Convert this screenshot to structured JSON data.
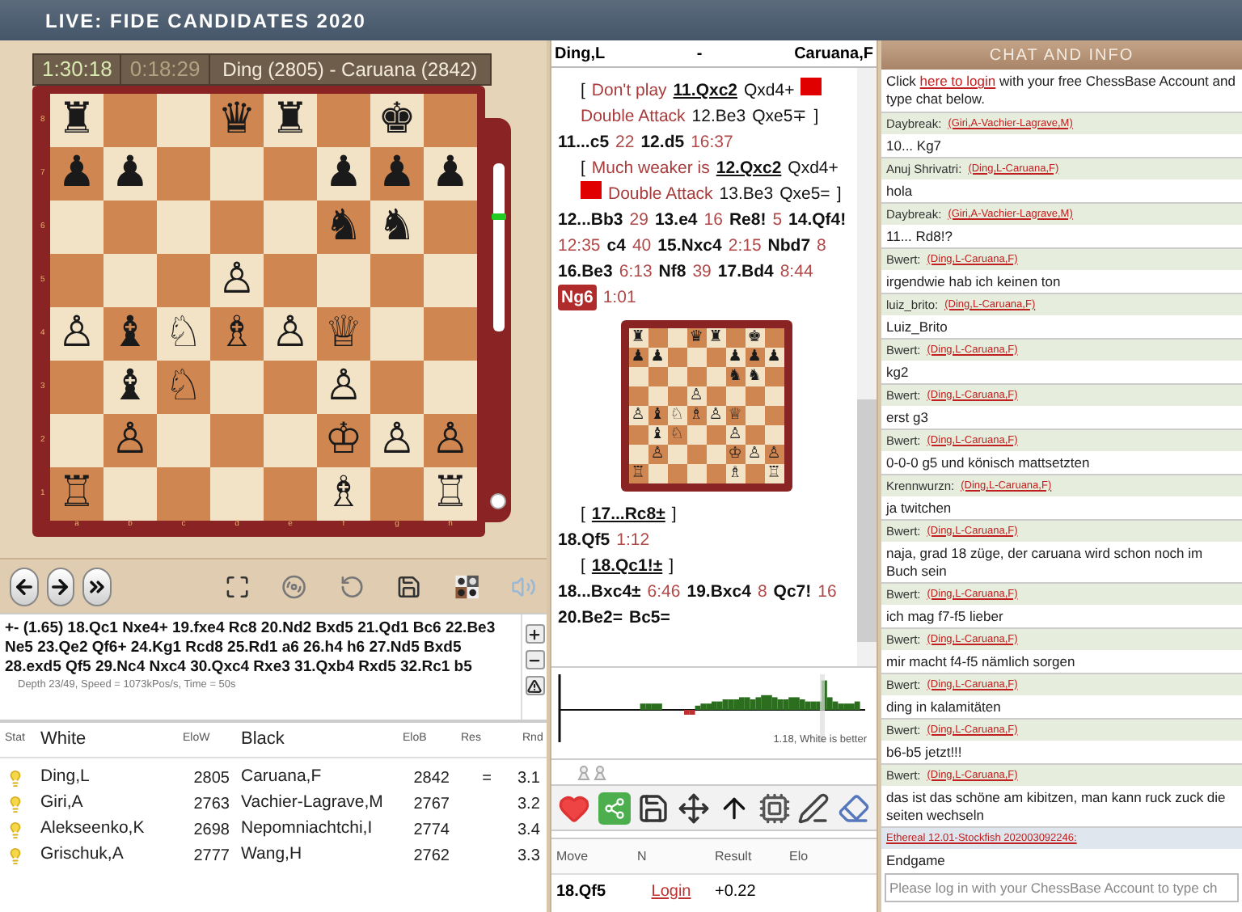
{
  "header": {
    "title": "LIVE: FIDE CANDIDATES 2020"
  },
  "board_panel": {
    "clocks": [
      {
        "time": "1:30:18",
        "active": true
      },
      {
        "time": "0:18:29",
        "active": false
      }
    ],
    "game_title": "Ding (2805) - Caruana (2842)",
    "ranks": [
      [
        {
          "kind": "piece",
          "glyph": "♜"
        },
        {
          "kind": "empty"
        },
        {
          "kind": "empty"
        },
        {
          "kind": "piece",
          "glyph": "♛"
        },
        {
          "kind": "piece",
          "glyph": "♜"
        },
        {
          "kind": "empty"
        },
        {
          "kind": "piece",
          "glyph": "♚"
        },
        {
          "kind": "empty"
        }
      ],
      [
        {
          "kind": "piece",
          "glyph": "♟"
        },
        {
          "kind": "piece",
          "glyph": "♟"
        },
        {
          "kind": "empty"
        },
        {
          "kind": "empty"
        },
        {
          "kind": "empty"
        },
        {
          "kind": "piece",
          "glyph": "♟"
        },
        {
          "kind": "piece",
          "glyph": "♟"
        },
        {
          "kind": "piece",
          "glyph": "♟"
        }
      ],
      [
        {
          "kind": "empty"
        },
        {
          "kind": "empty"
        },
        {
          "kind": "empty"
        },
        {
          "kind": "empty"
        },
        {
          "kind": "empty"
        },
        {
          "kind": "piece",
          "glyph": "♞"
        },
        {
          "kind": "piece",
          "glyph": "♞"
        },
        {
          "kind": "empty"
        }
      ],
      [
        {
          "kind": "empty"
        },
        {
          "kind": "empty"
        },
        {
          "kind": "empty"
        },
        {
          "kind": "piece",
          "glyph": "♙"
        },
        {
          "kind": "empty"
        },
        {
          "kind": "empty"
        },
        {
          "kind": "empty"
        },
        {
          "kind": "empty"
        }
      ],
      [
        {
          "kind": "piece",
          "glyph": "♙"
        },
        {
          "kind": "piece",
          "glyph": "♝"
        },
        {
          "kind": "piece",
          "glyph": "♘"
        },
        {
          "kind": "piece",
          "glyph": "♗"
        },
        {
          "kind": "piece",
          "glyph": "♙"
        },
        {
          "kind": "piece",
          "glyph": "♕"
        },
        {
          "kind": "empty"
        },
        {
          "kind": "empty"
        }
      ],
      [
        {
          "kind": "empty"
        },
        {
          "kind": "piece",
          "glyph": "♝"
        },
        {
          "kind": "piece",
          "glyph": "♘"
        },
        {
          "kind": "empty"
        },
        {
          "kind": "empty"
        },
        {
          "kind": "piece",
          "glyph": "♙"
        },
        {
          "kind": "empty"
        },
        {
          "kind": "empty"
        }
      ],
      [
        {
          "kind": "empty"
        },
        {
          "kind": "piece",
          "glyph": "♙"
        },
        {
          "kind": "empty"
        },
        {
          "kind": "empty"
        },
        {
          "kind": "empty"
        },
        {
          "kind": "piece",
          "glyph": "♔"
        },
        {
          "kind": "piece",
          "glyph": "♙"
        },
        {
          "kind": "piece",
          "glyph": "♙"
        }
      ],
      [
        {
          "kind": "piece",
          "glyph": "♖"
        },
        {
          "kind": "empty"
        },
        {
          "kind": "empty"
        },
        {
          "kind": "empty"
        },
        {
          "kind": "empty"
        },
        {
          "kind": "piece",
          "glyph": "♗"
        },
        {
          "kind": "empty"
        },
        {
          "kind": "piece",
          "glyph": "♖"
        }
      ]
    ],
    "rank_labels": [
      "8",
      "7",
      "6",
      "5",
      "4",
      "3",
      "2",
      "1"
    ],
    "file_labels": [
      "a",
      "b",
      "c",
      "d",
      "e",
      "f",
      "g",
      "h"
    ],
    "eval_bar": {
      "level": 0.68
    }
  },
  "board_toolbar": [
    {
      "kind": "back"
    },
    {
      "kind": "forward"
    },
    {
      "kind": "end"
    },
    {
      "kind": "fullscreen"
    },
    {
      "kind": "wheel"
    },
    {
      "kind": "rotate"
    },
    {
      "kind": "save"
    },
    {
      "kind": "pieces"
    },
    {
      "kind": "sound"
    }
  ],
  "engine": {
    "line": "+- (1.65) 18.Qc1 Nxe4+ 19.fxe4 Rc8 20.Nd2 Bxd5 21.Qd1 Bc6 22.Be3 Ne5 23.Qe2 Qf6+ 24.Kg1 Rcd8 25.Rd1 a6 26.h4 h6 27.Nd5 Bxd5 28.exd5 Qf5 29.Nc4 Nxc4 30.Qxc4 Rxe3 31.Qxb4 Rxd5 32.Rc1 b5",
    "info": "Depth 23/49, Speed = 1073kPos/s, Time = 50s",
    "buttons": [
      {
        "kind": "plus"
      },
      {
        "kind": "minus"
      },
      {
        "kind": "warning"
      }
    ]
  },
  "games_table": {
    "columns": [
      "Stat",
      "White",
      "EloW",
      "Black",
      "EloB",
      "Res",
      "Rnd"
    ],
    "rows": [
      {
        "white": "Ding,L",
        "elo_w": "2805",
        "black": "Caruana,F",
        "elo_b": "2842",
        "result": "=",
        "round": "3.1"
      },
      {
        "white": "Giri,A",
        "elo_w": "2763",
        "black": "Vachier-Lagrave,M",
        "elo_b": "2767",
        "round": "3.2"
      },
      {
        "white": "Alekseenko,K",
        "elo_w": "2698",
        "black": "Nepomniachtchi,I",
        "elo_b": "2774",
        "round": "3.4"
      },
      {
        "white": "Grischuk,A",
        "elo_w": "2777",
        "black": "Wang,H",
        "elo_b": "2762",
        "round": "3.3"
      }
    ]
  },
  "notation": {
    "white": "Ding,L",
    "separator": "-",
    "black": "Caruana,F",
    "paragraphs": [
      {
        "kind": "variation",
        "tokens": [
          {
            "kind": "bracket",
            "text": "["
          },
          {
            "kind": "comment",
            "text": "Don't play"
          },
          {
            "kind": "link",
            "text": "11.Qxc2"
          },
          {
            "kind": "plain",
            "text": "Qxd4+"
          },
          {
            "kind": "marker"
          },
          {
            "kind": "comment",
            "text": "Double Attack"
          },
          {
            "kind": "plain",
            "text": "12.Be3"
          },
          {
            "kind": "plain",
            "text": "Qxe5∓"
          },
          {
            "kind": "bracket",
            "text": "]"
          }
        ]
      },
      {
        "kind": "main",
        "tokens": [
          {
            "kind": "move",
            "text": "11...c5"
          },
          {
            "kind": "time",
            "text": "22"
          },
          {
            "kind": "move",
            "text": "12.d5"
          },
          {
            "kind": "time",
            "text": "16:37"
          }
        ]
      },
      {
        "kind": "variation",
        "tokens": [
          {
            "kind": "bracket",
            "text": "["
          },
          {
            "kind": "comment",
            "text": "Much weaker is"
          },
          {
            "kind": "link",
            "text": "12.Qxc2"
          },
          {
            "kind": "plain",
            "text": "Qxd4+"
          },
          {
            "kind": "marker"
          },
          {
            "kind": "comment",
            "text": "Double Attack"
          },
          {
            "kind": "plain",
            "text": "13.Be3"
          },
          {
            "kind": "plain",
            "text": "Qxe5="
          },
          {
            "kind": "bracket",
            "text": "]"
          }
        ]
      },
      {
        "kind": "main",
        "tokens": [
          {
            "kind": "move",
            "text": "12...Bb3"
          },
          {
            "kind": "time",
            "text": "29"
          },
          {
            "kind": "move",
            "text": "13.e4"
          },
          {
            "kind": "time",
            "text": "16"
          },
          {
            "kind": "move",
            "text": "Re8!"
          },
          {
            "kind": "time",
            "text": "5"
          },
          {
            "kind": "move",
            "text": "14.Qf4!"
          },
          {
            "kind": "time",
            "text": "12:35"
          },
          {
            "kind": "move",
            "text": "c4"
          },
          {
            "kind": "time",
            "text": "40"
          },
          {
            "kind": "move",
            "text": "15.Nxc4"
          },
          {
            "kind": "time",
            "text": "2:15"
          },
          {
            "kind": "move",
            "text": "Nbd7"
          },
          {
            "kind": "time",
            "text": "8"
          },
          {
            "kind": "move",
            "text": "16.Be3"
          },
          {
            "kind": "time",
            "text": "6:13"
          },
          {
            "kind": "move",
            "text": "Nf8"
          },
          {
            "kind": "time",
            "text": "39"
          },
          {
            "kind": "move",
            "text": "17.Bd4"
          },
          {
            "kind": "time",
            "text": "8:44"
          },
          {
            "kind": "current",
            "text": "Ng6"
          },
          {
            "kind": "time",
            "text": "1:01"
          }
        ]
      },
      {
        "kind": "diagram",
        "ranks": [
          [
            {
              "kind": "piece",
              "glyph": "♜"
            },
            {
              "kind": "empty"
            },
            {
              "kind": "empty"
            },
            {
              "kind": "piece",
              "glyph": "♛"
            },
            {
              "kind": "piece",
              "glyph": "♜"
            },
            {
              "kind": "empty"
            },
            {
              "kind": "piece",
              "glyph": "♚"
            },
            {
              "kind": "empty"
            }
          ],
          [
            {
              "kind": "piece",
              "glyph": "♟"
            },
            {
              "kind": "piece",
              "glyph": "♟"
            },
            {
              "kind": "empty"
            },
            {
              "kind": "empty"
            },
            {
              "kind": "empty"
            },
            {
              "kind": "piece",
              "glyph": "♟"
            },
            {
              "kind": "piece",
              "glyph": "♟"
            },
            {
              "kind": "piece",
              "glyph": "♟"
            }
          ],
          [
            {
              "kind": "empty"
            },
            {
              "kind": "empty"
            },
            {
              "kind": "empty"
            },
            {
              "kind": "empty"
            },
            {
              "kind": "empty"
            },
            {
              "kind": "piece",
              "glyph": "♞"
            },
            {
              "kind": "piece",
              "glyph": "♞"
            },
            {
              "kind": "empty"
            }
          ],
          [
            {
              "kind": "empty"
            },
            {
              "kind": "empty"
            },
            {
              "kind": "empty"
            },
            {
              "kind": "piece",
              "glyph": "♙"
            },
            {
              "kind": "empty"
            },
            {
              "kind": "empty"
            },
            {
              "kind": "empty"
            },
            {
              "kind": "empty"
            }
          ],
          [
            {
              "kind": "piece",
              "glyph": "♙"
            },
            {
              "kind": "piece",
              "glyph": "♝"
            },
            {
              "kind": "piece",
              "glyph": "♘"
            },
            {
              "kind": "piece",
              "glyph": "♗"
            },
            {
              "kind": "piece",
              "glyph": "♙"
            },
            {
              "kind": "piece",
              "glyph": "♕"
            },
            {
              "kind": "empty"
            },
            {
              "kind": "empty"
            }
          ],
          [
            {
              "kind": "empty"
            },
            {
              "kind": "piece",
              "glyph": "♝"
            },
            {
              "kind": "piece",
              "glyph": "♘"
            },
            {
              "kind": "empty"
            },
            {
              "kind": "empty"
            },
            {
              "kind": "piece",
              "glyph": "♙"
            },
            {
              "kind": "empty"
            },
            {
              "kind": "empty"
            }
          ],
          [
            {
              "kind": "empty"
            },
            {
              "kind": "piece",
              "glyph": "♙"
            },
            {
              "kind": "empty"
            },
            {
              "kind": "empty"
            },
            {
              "kind": "empty"
            },
            {
              "kind": "piece",
              "glyph": "♔"
            },
            {
              "kind": "piece",
              "glyph": "♙"
            },
            {
              "kind": "piece",
              "glyph": "♙"
            }
          ],
          [
            {
              "kind": "piece",
              "glyph": "♖"
            },
            {
              "kind": "empty"
            },
            {
              "kind": "empty"
            },
            {
              "kind": "empty"
            },
            {
              "kind": "empty"
            },
            {
              "kind": "piece",
              "glyph": "♗"
            },
            {
              "kind": "empty"
            },
            {
              "kind": "piece",
              "glyph": "♖"
            }
          ]
        ]
      },
      {
        "kind": "variation",
        "tokens": [
          {
            "kind": "bracket",
            "text": "["
          },
          {
            "kind": "link",
            "text": "17...Rc8±"
          },
          {
            "kind": "bracket",
            "text": "]"
          }
        ]
      },
      {
        "kind": "main",
        "tokens": [
          {
            "kind": "move",
            "text": "18.Qf5"
          },
          {
            "kind": "time",
            "text": "1:12"
          }
        ]
      },
      {
        "kind": "variation",
        "tokens": [
          {
            "kind": "bracket",
            "text": "["
          },
          {
            "kind": "link",
            "text": "18.Qc1!±"
          },
          {
            "kind": "bracket",
            "text": "]"
          }
        ]
      },
      {
        "kind": "main",
        "tokens": [
          {
            "kind": "move",
            "text": "18...Bxc4±"
          },
          {
            "kind": "time",
            "text": "6:46"
          },
          {
            "kind": "move",
            "text": "19.Bxc4"
          },
          {
            "kind": "time",
            "text": "8"
          },
          {
            "kind": "move",
            "text": "Qc7!"
          },
          {
            "kind": "time",
            "text": "16"
          }
        ]
      },
      {
        "kind": "main",
        "tokens": [
          {
            "kind": "move",
            "text": "20.Be2="
          },
          {
            "kind": "move",
            "text": "Bc5="
          }
        ]
      }
    ]
  },
  "eval_graph": {
    "caption": "1.18, White is better"
  },
  "tools": [
    {
      "kind": "heart"
    },
    {
      "kind": "share"
    },
    {
      "kind": "save"
    },
    {
      "kind": "move"
    },
    {
      "kind": "up"
    },
    {
      "kind": "engine"
    },
    {
      "kind": "pen"
    },
    {
      "kind": "eraser"
    }
  ],
  "moves_table": {
    "columns": [
      "Move",
      "N",
      "Result",
      "Elo"
    ],
    "rows": [
      {
        "move": "18.Qf5",
        "n": "Login",
        "result": "+0.22"
      }
    ]
  },
  "chat": {
    "title": "CHAT AND INFO",
    "intro": {
      "before": "Click",
      "link": "here to login",
      "after": "with your free ChessBase Account and type chat below."
    },
    "messages": [
      {
        "kind": "user",
        "author": "Daybreak:",
        "game": "(Giri,A-Vachier-Lagrave,M)",
        "text": "10... Kg7"
      },
      {
        "kind": "user",
        "author": "Anuj Shrivatri:",
        "game": "(Ding,L-Caruana,F)",
        "text": "hola"
      },
      {
        "kind": "user",
        "author": "Daybreak:",
        "game": "(Giri,A-Vachier-Lagrave,M)",
        "text": "11... Rd8!?"
      },
      {
        "kind": "user",
        "author": "Bwert:",
        "game": "(Ding,L-Caruana,F)",
        "text": "irgendwie hab ich keinen ton"
      },
      {
        "kind": "user",
        "author": "luiz_brito:",
        "game": "(Ding,L-Caruana,F)",
        "text": "Luiz_Brito"
      },
      {
        "kind": "user",
        "author": "Bwert:",
        "game": "(Ding,L-Caruana,F)",
        "text": "kg2"
      },
      {
        "kind": "user",
        "author": "Bwert:",
        "game": "(Ding,L-Caruana,F)",
        "text": "erst g3"
      },
      {
        "kind": "user",
        "author": "Bwert:",
        "game": "(Ding,L-Caruana,F)",
        "text": "0-0-0 g5 und könisch mattsetzten"
      },
      {
        "kind": "user",
        "author": "Krennwurzn:",
        "game": "(Ding,L-Caruana,F)",
        "text": "ja twitchen"
      },
      {
        "kind": "user",
        "author": "Bwert:",
        "game": "(Ding,L-Caruana,F)",
        "text": "naja, grad 18 züge, der caruana wird schon noch im Buch sein"
      },
      {
        "kind": "user",
        "author": "Bwert:",
        "game": "(Ding,L-Caruana,F)",
        "text": "ich mag f7-f5 lieber"
      },
      {
        "kind": "user",
        "author": "Bwert:",
        "game": "(Ding,L-Caruana,F)",
        "text": "mir macht f4-f5 nämlich sorgen"
      },
      {
        "kind": "user",
        "author": "Bwert:",
        "game": "(Ding,L-Caruana,F)",
        "text": "ding in kalamitäten"
      },
      {
        "kind": "user",
        "author": "Bwert:",
        "game": "(Ding,L-Caruana,F)",
        "text": "b6-b5 jetzt!!!"
      },
      {
        "kind": "user",
        "author": "Bwert:",
        "game": "(Ding,L-Caruana,F)",
        "text": "das ist das schöne am kibitzen, man kann ruck zuck die seiten wechseln"
      },
      {
        "kind": "engine",
        "game": "Ethereal 12.01-Stockfish 202003092246:",
        "text": "Endgame"
      }
    ],
    "input": {
      "placeholder": "Please log in with your ChessBase Account to type ch"
    }
  }
}
